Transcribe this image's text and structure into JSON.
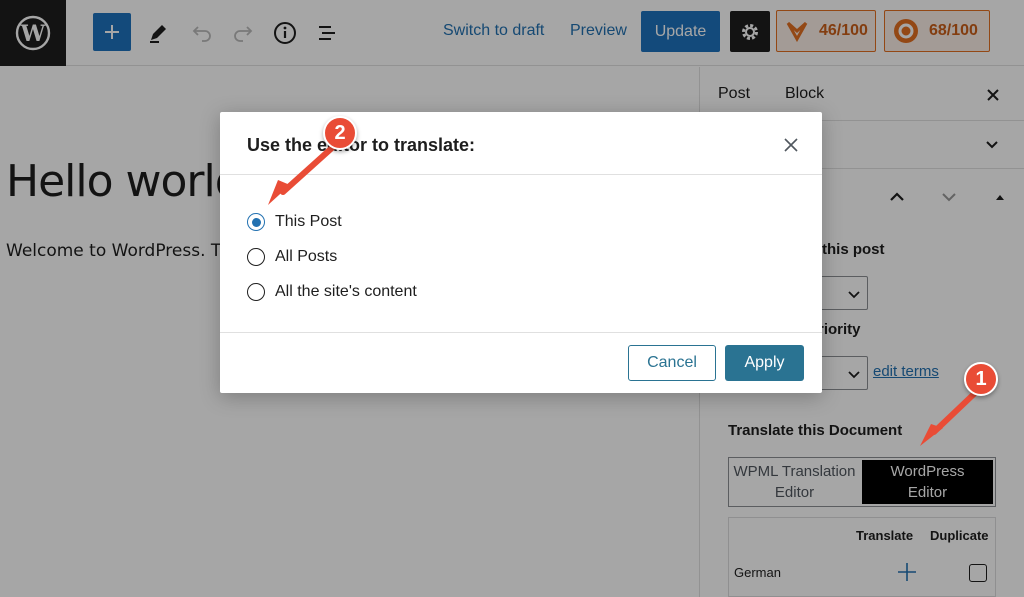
{
  "topbar": {
    "switch_to_draft": "Switch to draft",
    "preview": "Preview",
    "update": "Update",
    "score_seo": "46/100",
    "score_read": "68/100"
  },
  "editor": {
    "title": "Hello world",
    "body": "Welcome to WordPress. This"
  },
  "sidebar": {
    "tab_post": "Post",
    "tab_block": "Block",
    "partial_heading_1": "this post",
    "partial_heading_2": "riority",
    "edit_terms": "edit terms",
    "translate_heading": "Translate this Document",
    "seg_wpml_line1": "WPML Translation",
    "seg_wpml_line2": "Editor",
    "seg_wp_line1": "WordPress",
    "seg_wp_line2": "Editor",
    "col_translate": "Translate",
    "col_duplicate": "Duplicate",
    "lang_german": "German"
  },
  "modal": {
    "title": "Use the editor to translate:",
    "options": [
      "This Post",
      "All Posts",
      "All the site's content"
    ],
    "selected_index": 0,
    "cancel": "Cancel",
    "apply": "Apply"
  },
  "annotations": {
    "badge_1": "1",
    "badge_2": "2"
  },
  "colors": {
    "wp_blue": "#1e72bd",
    "apply_teal": "#2a7392",
    "badge_red": "#e94c36",
    "score_orange": "#e26f21"
  }
}
